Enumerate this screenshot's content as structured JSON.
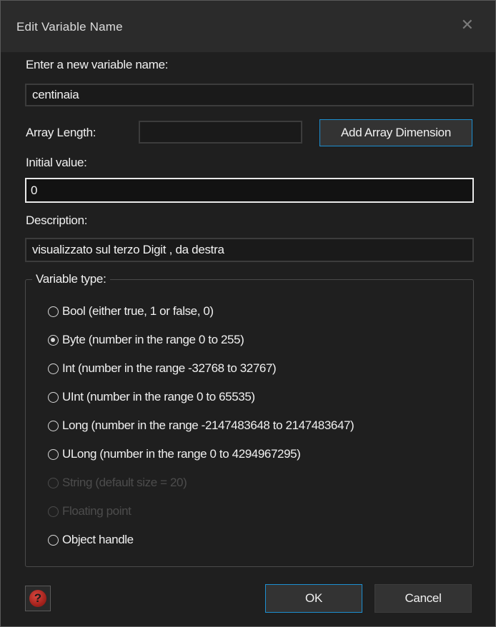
{
  "window": {
    "title": "Edit Variable Name",
    "close_glyph": "✕"
  },
  "name_section": {
    "label": "Enter a new variable name:",
    "value": "centinaia"
  },
  "array": {
    "label": "Array Length:",
    "value": "",
    "add_button": "Add Array Dimension"
  },
  "initial": {
    "label": "Initial value:",
    "value": "0"
  },
  "description": {
    "label": "Description:",
    "value": "visualizzato sul terzo Digit , da destra"
  },
  "variable_type": {
    "legend": "Variable type:",
    "selected": "Byte",
    "options": [
      {
        "label": "Bool (either true, 1 or false, 0)",
        "checked": false,
        "enabled": true
      },
      {
        "label": "Byte (number in the range 0 to 255)",
        "checked": true,
        "enabled": true
      },
      {
        "label": "Int (number in the range -32768 to 32767)",
        "checked": false,
        "enabled": true
      },
      {
        "label": "UInt (number in the range 0 to 65535)",
        "checked": false,
        "enabled": true
      },
      {
        "label": "Long (number in the range -2147483648 to 2147483647)",
        "checked": false,
        "enabled": true
      },
      {
        "label": "ULong (number in the range 0 to 4294967295)",
        "checked": false,
        "enabled": true
      },
      {
        "label": "String (default size = 20)",
        "checked": false,
        "enabled": false
      },
      {
        "label": "Floating point",
        "checked": false,
        "enabled": false
      },
      {
        "label": "Object handle",
        "checked": false,
        "enabled": true
      }
    ]
  },
  "footer": {
    "help_icon": "help-icon",
    "help_glyph": "?",
    "ok_label": "OK",
    "cancel_label": "Cancel"
  },
  "colors": {
    "accent": "#1c8fd1",
    "background": "#1f1f1f",
    "titlebar": "#2b2b2b",
    "help_red": "#a5231d"
  }
}
